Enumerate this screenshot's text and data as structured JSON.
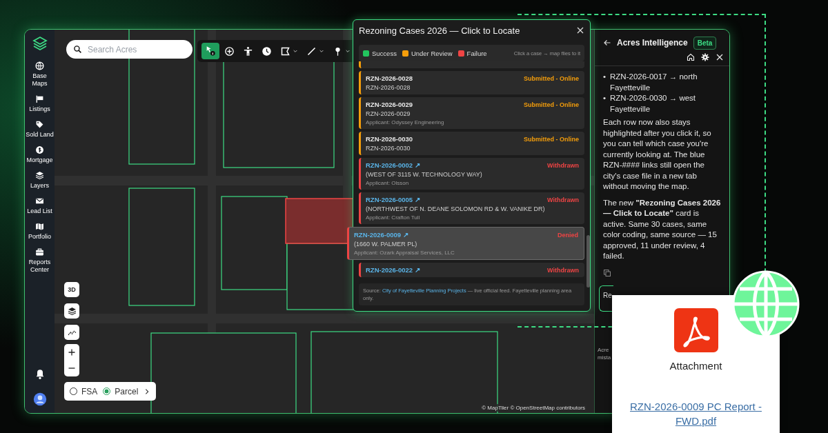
{
  "sidebar": {
    "items": [
      {
        "label": "Base Maps"
      },
      {
        "label": "Listings"
      },
      {
        "label": "Sold Land"
      },
      {
        "label": "Mortgage"
      },
      {
        "label": "Layers"
      },
      {
        "label": "Lead List"
      },
      {
        "label": "Portfolio"
      },
      {
        "label": "Reports Center"
      }
    ]
  },
  "search": {
    "placeholder": "Search Acres"
  },
  "toolbar": {
    "tools": [
      {
        "selected": true,
        "dropdown": false
      },
      {
        "selected": false,
        "dropdown": false
      },
      {
        "selected": false,
        "dropdown": false
      },
      {
        "selected": false,
        "dropdown": false
      },
      {
        "selected": false,
        "dropdown": true
      },
      {
        "selected": false,
        "dropdown": true
      },
      {
        "selected": false,
        "dropdown": true
      }
    ]
  },
  "map_controls": {
    "view_button": "3D",
    "mode_options": [
      {
        "label": "FSA",
        "selected": false
      },
      {
        "label": "Parcel",
        "selected": true
      }
    ]
  },
  "attribution": "© MapTiler © OpenStreetMap contributors",
  "cases_panel": {
    "title": "Rezoning Cases 2026 — Click to Locate",
    "legend": [
      {
        "label": "Success",
        "color": "#22c55e"
      },
      {
        "label": "Under Review",
        "color": "#f59e0b"
      },
      {
        "label": "Failure",
        "color": "#ef4444"
      }
    ],
    "hint": "Click a case → map flies to it",
    "cases": [
      {
        "id": "RZN-2026-0028",
        "status": "Submitted - Online",
        "color": "#f59e0b",
        "selected": false,
        "subtitle": "RZN-2026-0028"
      },
      {
        "id": "RZN-2026-0029",
        "status": "Submitted - Online",
        "color": "#f59e0b",
        "selected": false,
        "subtitle": "RZN-2026-0029",
        "applicant": "Applicant: Odyssey Engineering"
      },
      {
        "id": "RZN-2026-0030",
        "status": "Submitted - Online",
        "color": "#f59e0b",
        "selected": false,
        "subtitle": "RZN-2026-0030"
      },
      {
        "id": "RZN-2026-0002",
        "link_icon": "↗",
        "status": "Withdrawn",
        "color": "#ef4444",
        "selected": false,
        "subtitle": "(WEST OF 3115 W. TECHNOLOGY WAY)",
        "applicant": "Applicant: Olsson"
      },
      {
        "id": "RZN-2026-0005",
        "link_icon": "↗",
        "status": "Withdrawn",
        "color": "#ef4444",
        "selected": false,
        "subtitle": "(NORTHWEST OF N. DEANE SOLOMON RD & W. VANIKE DR)",
        "applicant": "Applicant: Crafton Tull"
      },
      {
        "id": "RZN-2026-0009",
        "link_icon": "↗",
        "status": "Denied",
        "color": "#ef4444",
        "selected": true,
        "subtitle": "(1660 W. PALMER PL)",
        "applicant": "Applicant: Ozark Appraisal Services, LLC"
      },
      {
        "id": "RZN-2026-0022",
        "link_icon": "↗",
        "status": "Withdrawn",
        "color": "#ef4444",
        "selected": false
      }
    ],
    "source": {
      "prefix": "Source: ",
      "link": "City of Fayetteville Planning Projects",
      "suffix": " — live official feed. Fayetteville planning area only."
    }
  },
  "ai_panel": {
    "title": "Acres Intelligence",
    "badge": "Beta",
    "bullets": [
      {
        "marker": "•",
        "text": "RZN-2026-0017 → north Fayetteville"
      },
      {
        "marker": "•",
        "text": "RZN-2026-0030 → west Fayetteville"
      }
    ],
    "paragraphs": [
      "Each row now also stays highlighted after you click it, so you can tell which case you're currently looking at. The blue RZN-#### links still open the city's case file in a new tab without moving the map.",
      "The new **\"Rezoning Cases 2026 — Click to Locate\"** card is active. Same 30 cases, same color coding, same source — 15 approved, 11 under review, 4 failed."
    ],
    "cut_button": "Re",
    "cut_note": [
      "Acre",
      "mista"
    ]
  },
  "attachment": {
    "label": "Attachment",
    "file": "RZN-2026-0009 PC Report - FWD.pdf"
  }
}
